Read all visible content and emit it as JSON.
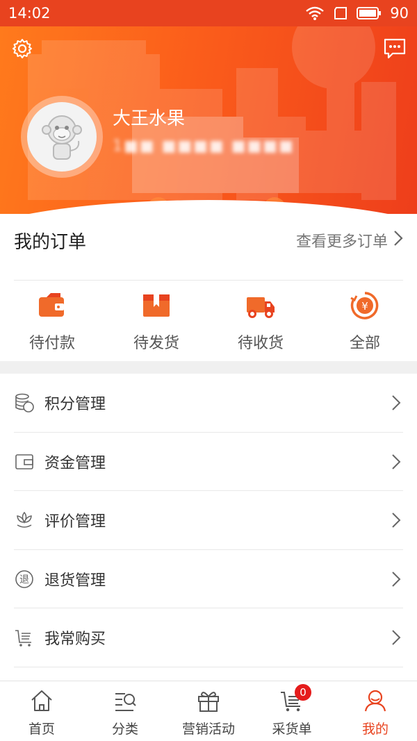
{
  "status_bar": {
    "time": "14:02",
    "battery": "90"
  },
  "header": {
    "user_name": "大王水果",
    "phone_masked": "1■■ ■■■■ ■■■■"
  },
  "orders": {
    "title": "我的订单",
    "more_label": "查看更多订单",
    "items": [
      {
        "label": "待付款",
        "icon": "wallet-icon"
      },
      {
        "label": "待发货",
        "icon": "box-icon"
      },
      {
        "label": "待收货",
        "icon": "truck-icon"
      },
      {
        "label": "全部",
        "icon": "yuan-circle-icon"
      }
    ]
  },
  "menu": [
    {
      "label": "积分管理",
      "icon": "coins-icon"
    },
    {
      "label": "资金管理",
      "icon": "wallet-outline-icon"
    },
    {
      "label": "评价管理",
      "icon": "lotus-icon"
    },
    {
      "label": "退货管理",
      "icon": "return-icon",
      "glyph": "退"
    },
    {
      "label": "我常购买",
      "icon": "cart-list-icon"
    }
  ],
  "bottom_nav": [
    {
      "label": "首页",
      "icon": "home-icon"
    },
    {
      "label": "分类",
      "icon": "category-search-icon"
    },
    {
      "label": "营销活动",
      "icon": "gift-icon"
    },
    {
      "label": "采货单",
      "icon": "cart-icon",
      "badge": "0"
    },
    {
      "label": "我的",
      "icon": "user-icon",
      "active": true
    }
  ],
  "colors": {
    "accent": "#e8431f",
    "orange": "#fb5d1b",
    "badge": "#e51c1c"
  }
}
